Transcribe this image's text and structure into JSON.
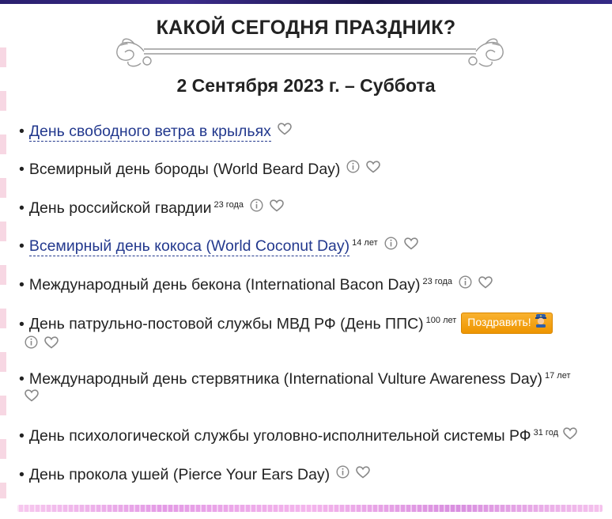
{
  "page": {
    "title": "КАКОЙ СЕГОДНЯ ПРАЗДНИК?",
    "date": "2 Сентября 2023 г. – Суббота",
    "greet_button_label": "Поздравить!"
  },
  "holidays": [
    {
      "name": "День свободного ветра в крыльях",
      "link": true,
      "age": "",
      "info": false
    },
    {
      "name": "Всемирный день бороды (World Beard Day)",
      "link": false,
      "age": "",
      "info": true
    },
    {
      "name": "День российской гвардии",
      "link": false,
      "age": "23 года",
      "info": true
    },
    {
      "name": "Всемирный день кокоса (World Coconut Day)",
      "link": true,
      "age": "14 лет",
      "info": true
    },
    {
      "name": "Международный день бекона (International Bacon Day)",
      "link": false,
      "age": "23 года",
      "info": true
    },
    {
      "name": "День патрульно-постовой службы МВД РФ (День ППС)",
      "link": false,
      "age": "100 лет",
      "info": true,
      "greet": true
    },
    {
      "name": "Международный день стервятника (International Vulture Awareness Day)",
      "link": false,
      "age": "17 лет",
      "info": false
    },
    {
      "name": "День психологической службы уголовно-исполнительной системы РФ",
      "link": false,
      "age": "31 год",
      "info": false
    },
    {
      "name": "День прокола ушей (Pierce Your Ears Day)",
      "link": false,
      "age": "",
      "info": true
    }
  ],
  "colors": {
    "link": "#23398e",
    "text": "#222222",
    "greet_button": "#f2a10c",
    "top_strip": "#2a1f6e"
  },
  "icons": {
    "info": "info-circle-icon",
    "favorite": "heart-outline-icon",
    "greet": "police-officer-emoji-icon",
    "ornament": "scroll-ornament-icon"
  }
}
